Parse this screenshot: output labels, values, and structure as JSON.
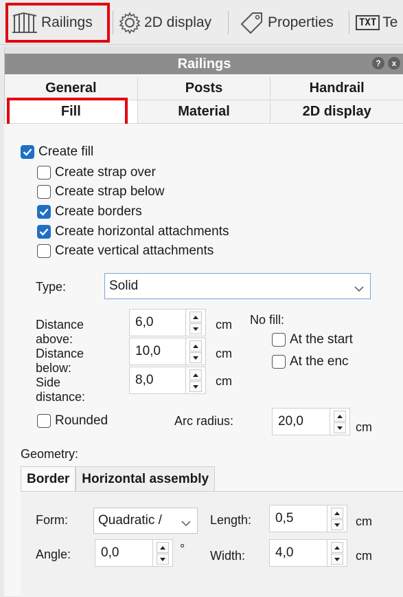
{
  "toolbar": {
    "railings_label": "Railings",
    "display2d_label": "2D display",
    "properties_label": "Properties",
    "txt_icon_label": "TXT",
    "text_label": "Te"
  },
  "panel": {
    "title": "Railings",
    "help_label": "?",
    "close_label": "x"
  },
  "tabs": {
    "row1": [
      "General",
      "Posts",
      "Handrail"
    ],
    "row2": [
      "Fill",
      "Material",
      "2D display"
    ]
  },
  "fill": {
    "create_fill": {
      "label": "Create fill",
      "checked": true
    },
    "create_strap_over": {
      "label": "Create strap over",
      "checked": false
    },
    "create_strap_below": {
      "label": "Create strap below",
      "checked": false
    },
    "create_borders": {
      "label": "Create borders",
      "checked": true
    },
    "create_horizontal_attachments": {
      "label": "Create horizontal attachments",
      "checked": true
    },
    "create_vertical_attachments": {
      "label": "Create vertical attachments",
      "checked": false
    },
    "type_label": "Type:",
    "type_value": "Solid",
    "distance_above_label": "Distance above:",
    "distance_above_value": "6,0",
    "distance_below_label": "Distance below:",
    "distance_below_value": "10,0",
    "side_distance_label": "Side distance:",
    "side_distance_value": "8,0",
    "unit_cm": "cm",
    "no_fill_label": "No fill:",
    "at_start": {
      "label": "At the start",
      "checked": false
    },
    "at_end": {
      "label": "At the enc",
      "checked": false
    },
    "rounded": {
      "label": "Rounded",
      "checked": false
    },
    "arc_radius_label": "Arc radius:",
    "arc_radius_value": "20,0"
  },
  "geometry": {
    "label": "Geometry:",
    "tabs": [
      "Border",
      "Horizontal assembly"
    ],
    "form_label": "Form:",
    "form_value": "Quadratic /",
    "length_label": "Length:",
    "length_value": "0,5",
    "angle_label": "Angle:",
    "angle_value": "0,0",
    "angle_unit": "°",
    "width_label": "Width:",
    "width_value": "4,0"
  },
  "colors": {
    "highlight": "#e3000f",
    "check_blue": "#1f6fc5",
    "title_bar": "#8d8d8d"
  }
}
